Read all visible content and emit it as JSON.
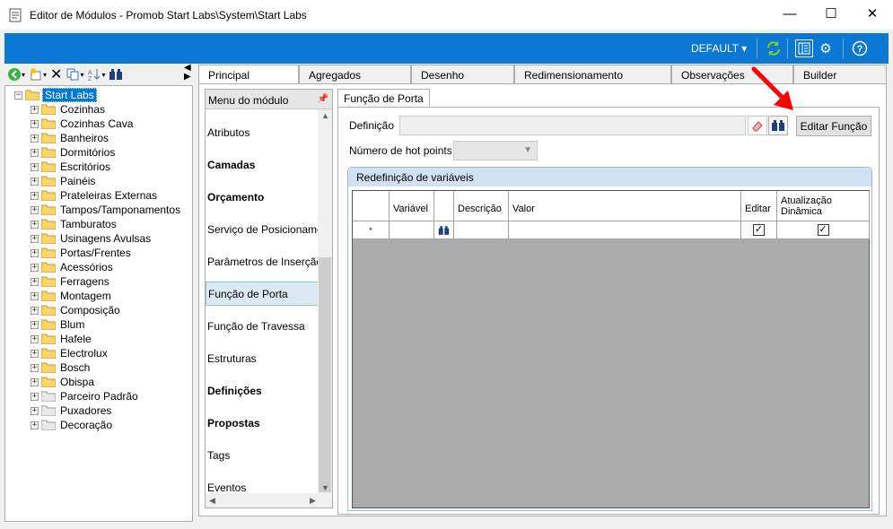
{
  "window": {
    "title": "Editor de Módulos - Promob Start Labs\\System\\Start Labs",
    "minimize": "—",
    "maximize": "☐",
    "close": "✕"
  },
  "toolbar": {
    "environment": "DEFAULT",
    "colors": {
      "bar": "#0b78d4",
      "arrow": "#ff0000"
    }
  },
  "tree": {
    "root": "Start Labs",
    "items": [
      "Cozinhas",
      "Cozinhas Cava",
      "Banheiros",
      "Dormitórios",
      "Escritórios",
      "Painéis",
      "Prateleiras Externas",
      "Tampos/Tamponamentos",
      "Tamburatos",
      "Usinagens Avulsas",
      "Portas/Frentes",
      "Acessórios",
      "Ferragens",
      "Montagem",
      "Composição",
      "Blum",
      "Hafele",
      "Electrolux",
      "Bosch",
      "Obispa",
      "Parceiro Padrão",
      "Puxadores",
      "Decoração"
    ]
  },
  "tabs": [
    "Principal",
    "Agregados",
    "Desenho",
    "Redimensionamento",
    "Observações",
    "Builder"
  ],
  "menu": {
    "header": "Menu do módulo",
    "items": [
      {
        "label": "Atributos",
        "bold": false
      },
      {
        "label": "Camadas",
        "bold": true
      },
      {
        "label": "Orçamento",
        "bold": true
      },
      {
        "label": "Serviço de Posicionamento",
        "bold": false
      },
      {
        "label": "Parâmetros de Inserção",
        "bold": false
      },
      {
        "label": "Função de Porta",
        "bold": false
      },
      {
        "label": "Função de Travessa",
        "bold": false
      },
      {
        "label": "Estruturas",
        "bold": false
      },
      {
        "label": "Definições",
        "bold": true
      },
      {
        "label": "Propostas",
        "bold": true
      },
      {
        "label": "Tags",
        "bold": false
      },
      {
        "label": "Eventos",
        "bold": false
      }
    ]
  },
  "funcao": {
    "subtab": "Função de Porta",
    "definicao_label": "Definição",
    "definicao_value": "",
    "edit_button": "Editar Função",
    "hotpoints_label": "Número de hot points",
    "hotpoints_value": "",
    "redef_title": "Redefinição de variáveis",
    "columns": [
      "Variável",
      "",
      "Descrição",
      "Valor",
      "Editar",
      "Atualização Dinâmica"
    ],
    "new_row_marker": "*",
    "row": {
      "editar": true,
      "atualizacao": true
    }
  }
}
